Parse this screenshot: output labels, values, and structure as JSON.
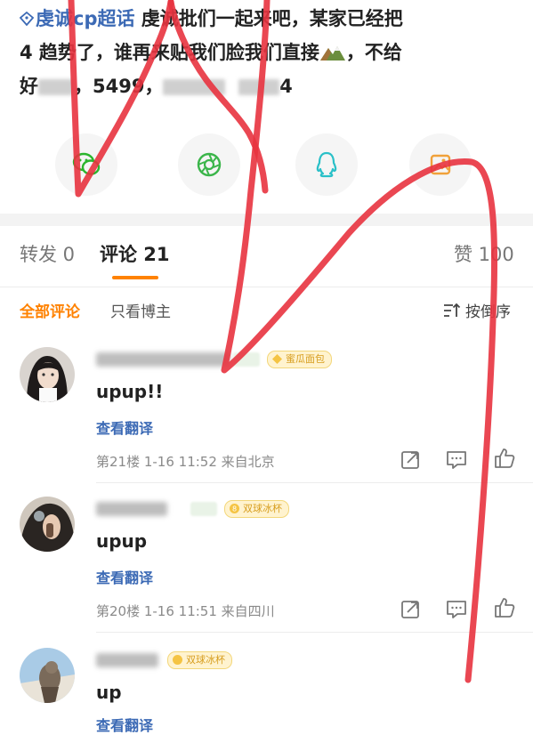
{
  "post": {
    "topic": "虔诚cp超话",
    "line1": "虔诚批们一起来吧，某家已经把",
    "line2": "4 趋势了，谁再来贴我们脸我们直接",
    "line2_tail": "，不给",
    "line3a": "好",
    "line3b": "，5499，",
    "line3c": "4"
  },
  "share": {
    "wechat": "wechat-icon",
    "moments": "moments-icon",
    "qq": "qq-icon",
    "image": "image-icon"
  },
  "tabs": {
    "repost": "转发 0",
    "comment": "评论 21",
    "like": "赞 100"
  },
  "filters": {
    "all": "全部评论",
    "owner": "只看博主",
    "sort": "按倒序"
  },
  "comments": [
    {
      "badge": "蜜瓜面包",
      "text": "upup!!",
      "translate": "查看翻译",
      "meta": "第21楼 1-16 11:52 来自北京"
    },
    {
      "badge": "双球冰杯",
      "text": "upup",
      "translate": "查看翻译",
      "meta": "第20楼 1-16 11:51 来自四川"
    },
    {
      "badge": "双球冰杯",
      "text": "up",
      "translate": "查看翻译",
      "meta": ""
    }
  ],
  "colors": {
    "accent": "#ff8200",
    "link": "#3c6ab5",
    "scribble": "#e8333f"
  }
}
